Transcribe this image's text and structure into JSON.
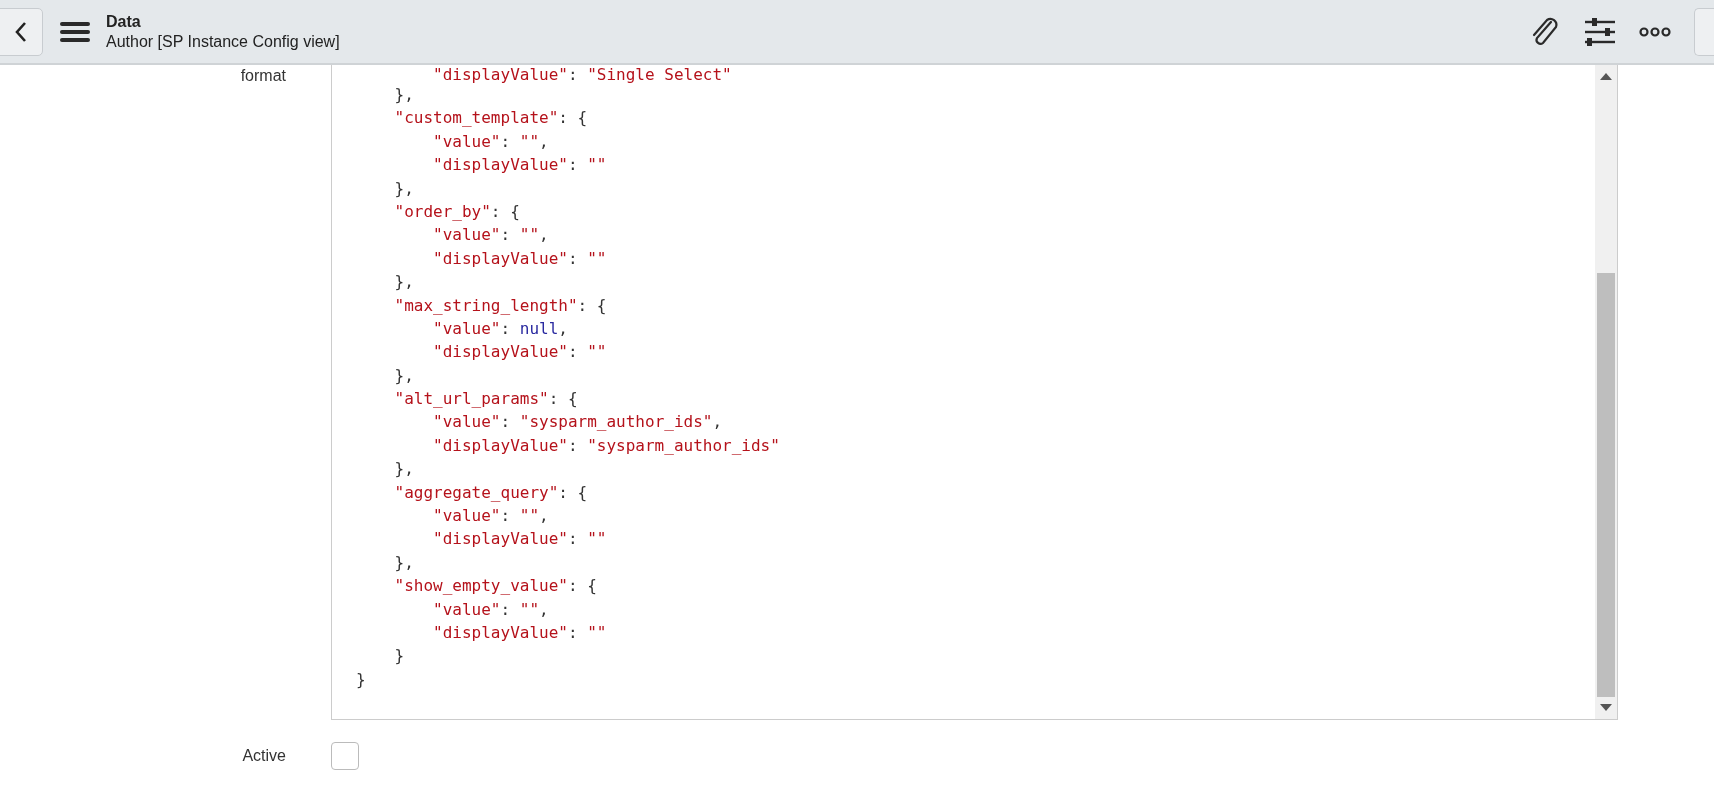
{
  "header": {
    "title": "Data",
    "subtitle": "Author [SP Instance Config view]"
  },
  "fields": [
    {
      "kind": "code",
      "label": "format",
      "lines": [
        [
          {
            "kind": "string",
            "text": "        \"displayValue\""
          },
          {
            "kind": "punct",
            "text": ": "
          },
          {
            "kind": "string",
            "text": "\"Single Select\""
          }
        ],
        [
          {
            "kind": "punct",
            "text": "    },"
          }
        ],
        [
          {
            "kind": "string",
            "text": "    \"custom_template\""
          },
          {
            "kind": "punct",
            "text": ": {"
          }
        ],
        [
          {
            "kind": "string",
            "text": "        \"value\""
          },
          {
            "kind": "punct",
            "text": ": "
          },
          {
            "kind": "string",
            "text": "\"\""
          },
          {
            "kind": "punct",
            "text": ","
          }
        ],
        [
          {
            "kind": "string",
            "text": "        \"displayValue\""
          },
          {
            "kind": "punct",
            "text": ": "
          },
          {
            "kind": "string",
            "text": "\"\""
          }
        ],
        [
          {
            "kind": "punct",
            "text": "    },"
          }
        ],
        [
          {
            "kind": "string",
            "text": "    \"order_by\""
          },
          {
            "kind": "punct",
            "text": ": {"
          }
        ],
        [
          {
            "kind": "string",
            "text": "        \"value\""
          },
          {
            "kind": "punct",
            "text": ": "
          },
          {
            "kind": "string",
            "text": "\"\""
          },
          {
            "kind": "punct",
            "text": ","
          }
        ],
        [
          {
            "kind": "string",
            "text": "        \"displayValue\""
          },
          {
            "kind": "punct",
            "text": ": "
          },
          {
            "kind": "string",
            "text": "\"\""
          }
        ],
        [
          {
            "kind": "punct",
            "text": "    },"
          }
        ],
        [
          {
            "kind": "string",
            "text": "    \"max_string_length\""
          },
          {
            "kind": "punct",
            "text": ": {"
          }
        ],
        [
          {
            "kind": "string",
            "text": "        \"value\""
          },
          {
            "kind": "punct",
            "text": ": "
          },
          {
            "kind": "null",
            "text": "null"
          },
          {
            "kind": "punct",
            "text": ","
          }
        ],
        [
          {
            "kind": "string",
            "text": "        \"displayValue\""
          },
          {
            "kind": "punct",
            "text": ": "
          },
          {
            "kind": "string",
            "text": "\"\""
          }
        ],
        [
          {
            "kind": "punct",
            "text": "    },"
          }
        ],
        [
          {
            "kind": "string",
            "text": "    \"alt_url_params\""
          },
          {
            "kind": "punct",
            "text": ": {"
          }
        ],
        [
          {
            "kind": "string",
            "text": "        \"value\""
          },
          {
            "kind": "punct",
            "text": ": "
          },
          {
            "kind": "string",
            "text": "\"sysparm_author_ids\""
          },
          {
            "kind": "punct",
            "text": ","
          }
        ],
        [
          {
            "kind": "string",
            "text": "        \"displayValue\""
          },
          {
            "kind": "punct",
            "text": ": "
          },
          {
            "kind": "string",
            "text": "\"sysparm_author_ids\""
          }
        ],
        [
          {
            "kind": "punct",
            "text": "    },"
          }
        ],
        [
          {
            "kind": "string",
            "text": "    \"aggregate_query\""
          },
          {
            "kind": "punct",
            "text": ": {"
          }
        ],
        [
          {
            "kind": "string",
            "text": "        \"value\""
          },
          {
            "kind": "punct",
            "text": ": "
          },
          {
            "kind": "string",
            "text": "\"\""
          },
          {
            "kind": "punct",
            "text": ","
          }
        ],
        [
          {
            "kind": "string",
            "text": "        \"displayValue\""
          },
          {
            "kind": "punct",
            "text": ": "
          },
          {
            "kind": "string",
            "text": "\"\""
          }
        ],
        [
          {
            "kind": "punct",
            "text": "    },"
          }
        ],
        [
          {
            "kind": "string",
            "text": "    \"show_empty_value\""
          },
          {
            "kind": "punct",
            "text": ": {"
          }
        ],
        [
          {
            "kind": "string",
            "text": "        \"value\""
          },
          {
            "kind": "punct",
            "text": ": "
          },
          {
            "kind": "string",
            "text": "\"\""
          },
          {
            "kind": "punct",
            "text": ","
          }
        ],
        [
          {
            "kind": "string",
            "text": "        \"displayValue\""
          },
          {
            "kind": "punct",
            "text": ": "
          },
          {
            "kind": "string",
            "text": "\"\""
          }
        ],
        [
          {
            "kind": "punct",
            "text": "    }"
          }
        ],
        [
          {
            "kind": "punct",
            "text": "}"
          }
        ]
      ]
    },
    {
      "kind": "checkbox",
      "label": "Active",
      "checked": false
    }
  ]
}
